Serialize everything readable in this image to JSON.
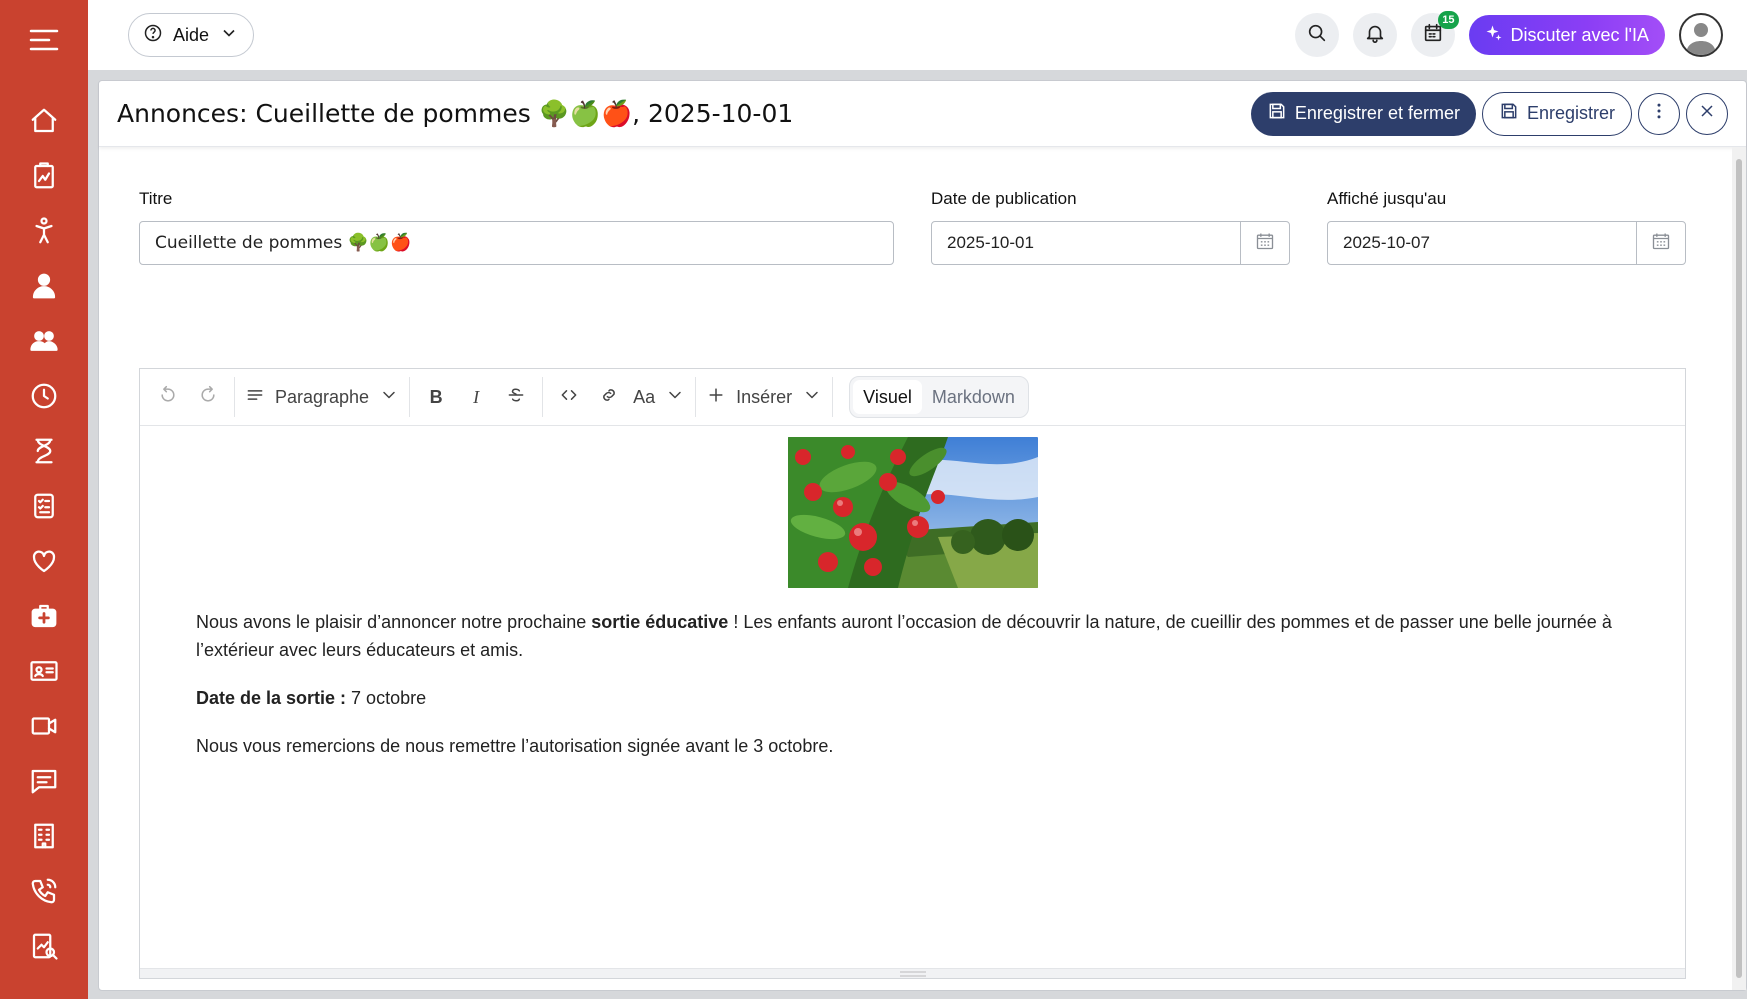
{
  "sidebar": {
    "menu_icon": "hamburger-icon",
    "items": [
      {
        "icon": "home-icon"
      },
      {
        "icon": "clipboard-chart-icon"
      },
      {
        "icon": "child-icon"
      },
      {
        "icon": "user-icon"
      },
      {
        "icon": "users-icon"
      },
      {
        "icon": "clock-icon"
      },
      {
        "icon": "hourglass-icon"
      },
      {
        "icon": "checklist-icon"
      },
      {
        "icon": "heart-icon"
      },
      {
        "icon": "medical-kit-icon"
      },
      {
        "icon": "id-card-icon"
      },
      {
        "icon": "video-icon"
      },
      {
        "icon": "chat-icon"
      },
      {
        "icon": "building-icon"
      },
      {
        "icon": "phone-icon"
      },
      {
        "icon": "report-search-icon"
      }
    ],
    "color": "#c9422f"
  },
  "topbar": {
    "help_label": "Aide",
    "calendar_badge": "15",
    "ai_button_label": "Discuter avec l'IA"
  },
  "header": {
    "title": "Annonces: Cueillette de pommes 🌳🍏🍎, 2025-10-01",
    "save_close_label": "Enregistrer et fermer",
    "save_label": "Enregistrer"
  },
  "form": {
    "title_label": "Titre",
    "title_value": "Cueillette de pommes 🌳🍏🍎",
    "publish_label": "Date de publication",
    "publish_value": "2025-10-01",
    "until_label": "Affiché jusqu'au",
    "until_value": "2025-10-07"
  },
  "toolbar": {
    "paragraph_label": "Paragraphe",
    "bold": "B",
    "italic": "I",
    "font_size_label": "Aa",
    "insert_label": "Insérer",
    "mode_visual": "Visuel",
    "mode_markdown": "Markdown"
  },
  "content": {
    "p1_before": "Nous avons le plaisir d’annoncer notre prochaine ",
    "p1_bold": "sortie éducative",
    "p1_after": " !  Les enfants auront l’occasion de découvrir la nature, de cueillir des pommes et de passer une belle journée à l’extérieur avec leurs éducateurs et amis.",
    "p2_bold": "Date de la sortie :",
    "p2_after": " 7 octobre",
    "p3": "Nous vous remercions de nous remettre l’autorisation signée avant le 3 octobre."
  },
  "colors": {
    "primary": "#2d3e6b",
    "ai_gradient_start": "#6a3cf2",
    "ai_gradient_end": "#a34ef7",
    "badge": "#16a34a"
  }
}
